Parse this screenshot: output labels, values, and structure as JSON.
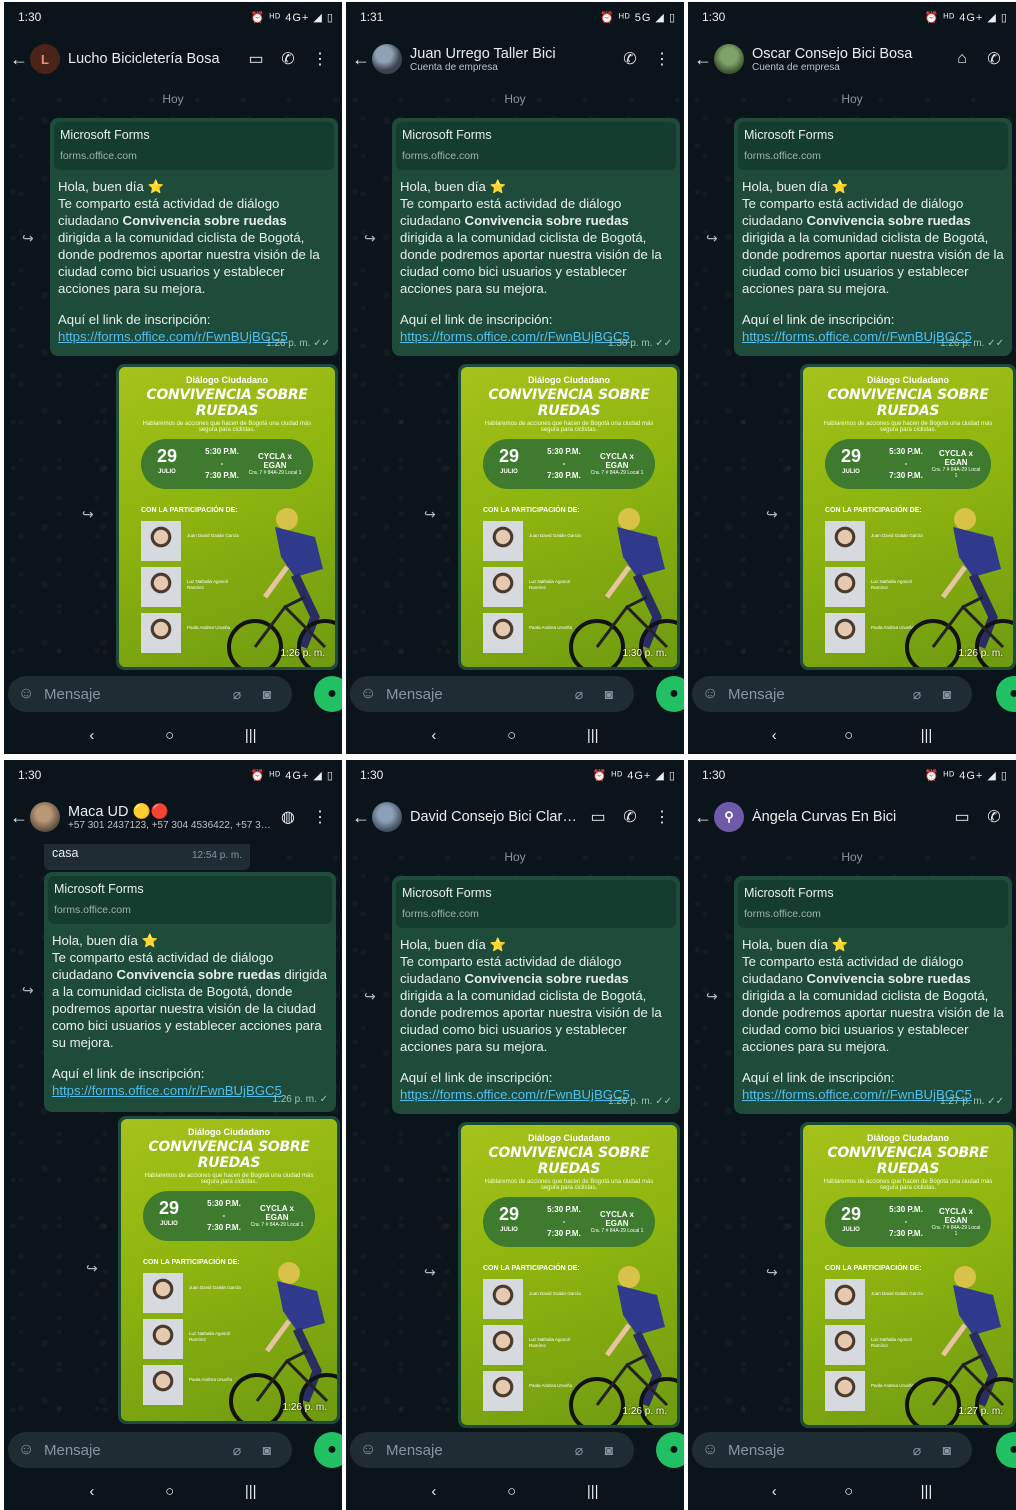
{
  "common": {
    "date_chip": "Hoy",
    "preview_title": "Microsoft Forms",
    "preview_url": "forms.office.com",
    "greeting": "Hola, buen día ⭐",
    "body_a": "Te comparto está actividad de diálogo ciudadano",
    "event_name": "Convivencia sobre ruedas",
    "body_b": "dirigida a la comunidad ciclista de Bogotá, donde podremos aportar nuestra visión de la ciudad como bici usuarios y establecer acciones para su mejora.",
    "link_label": "Aquí el link de inscripción:",
    "link_url": "https://forms.office.com/r/FwnBUjBGC5",
    "composer_placeholder": "Mensaje",
    "poster": {
      "header": "Diálogo Ciudadano",
      "title": "CONVIVENCIA SOBRE RUEDAS",
      "subtitle": "Hablaremos de acciones que hacen de Bogotá una ciudad más segura para ciclistas.",
      "day": "29",
      "month": "JULIO",
      "time_start": "5:30 P.M.",
      "time_end": "7:30 P.M.",
      "place": "CYCLA x EGAN",
      "place_addr": "Cra. 7 # 84A-29 Local 1",
      "participation": "CON LA PARTICIPACIÓN DE:",
      "p1": "Juan David Gaitán García",
      "p2": "Luz Nathalia Agosori Ramírez",
      "p3": "Paola Andrea Urueña"
    }
  },
  "screens": [
    {
      "status_time": "1:30",
      "status_icons": "⏰ ᴴᴰ 4G+ ◢ ▯",
      "contact": "Lucho Bicicletería Bosa",
      "subtitle": "",
      "avatar_letter": "L",
      "msg_time": "1:26 p. m.",
      "poster_time": "1:26 p. m."
    },
    {
      "status_time": "1:31",
      "status_icons": "⏰ ᴴᴰ 5G ◢ ▯",
      "contact": "Juan Urrego Taller Bici",
      "subtitle": "Cuenta de empresa",
      "avatar_letter": "",
      "msg_time": "1:30 p. m.",
      "poster_time": "1:30 p. m."
    },
    {
      "status_time": "1:30",
      "status_icons": "⏰ ᴴᴰ 4G+ ◢ ▯",
      "contact": "Oscar Consejo Bici Bosa",
      "subtitle": "Cuenta de empresa",
      "avatar_letter": "",
      "msg_time": "1:26 p. m.",
      "poster_time": "1:26 p. m."
    },
    {
      "status_time": "1:30",
      "status_icons": "⏰ ᴴᴰ 4G+ ◢ ▯",
      "contact": "Maca UD 🟡🔴",
      "subtitle": "+57 301 2437123, +57 304 4536422, +57 305 ...",
      "avatar_letter": "",
      "msg_time": "1:26 p. m.",
      "poster_time": "1:26 p. m.",
      "old_text": "casa",
      "old_time": "12:54 p. m."
    },
    {
      "status_time": "1:30",
      "status_icons": "⏰ ᴴᴰ 4G+ ◢ ▯",
      "contact": "David Consejo Bici Clareti...",
      "subtitle": "",
      "avatar_letter": "",
      "msg_time": "1:26 p. m.",
      "poster_time": "1:26 p. m."
    },
    {
      "status_time": "1:30",
      "status_icons": "⏰ ᴴᴰ 4G+ ◢ ▯",
      "contact": "Ángela Curvas En Bici",
      "subtitle": "",
      "avatar_letter": "",
      "msg_time": "1:27 p. m.",
      "poster_time": "1:27 p. m."
    }
  ]
}
